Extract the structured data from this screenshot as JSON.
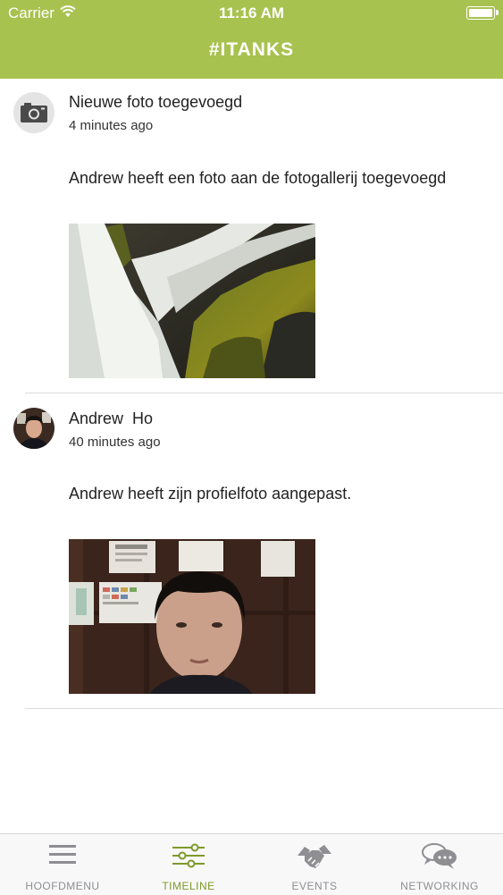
{
  "status_bar": {
    "carrier": "Carrier",
    "time": "11:16 AM"
  },
  "header": {
    "title": "#ITANKS"
  },
  "posts": [
    {
      "title": "Nieuwe foto toegevoegd",
      "time": "4 minutes ago",
      "body": "Andrew heeft een foto aan de fotogallerij toegevoegd",
      "avatar_icon": "camera-icon"
    },
    {
      "title": "Andrew  Ho",
      "time": "40 minutes ago",
      "body": "Andrew heeft zijn profielfoto aangepast.",
      "avatar_icon": "user-avatar"
    }
  ],
  "tabs": [
    {
      "label": "HOOFDMENU",
      "icon": "menu-icon",
      "active": false
    },
    {
      "label": "TIMELINE",
      "icon": "sliders-icon",
      "active": true
    },
    {
      "label": "EVENTS",
      "icon": "handshake-icon",
      "active": false
    },
    {
      "label": "NETWORKING",
      "icon": "chat-bubbles-icon",
      "active": false
    }
  ],
  "colors": {
    "header_bg": "#a8c24f",
    "active_tab": "#7d9a2a",
    "inactive_tab": "#8e8e93"
  }
}
